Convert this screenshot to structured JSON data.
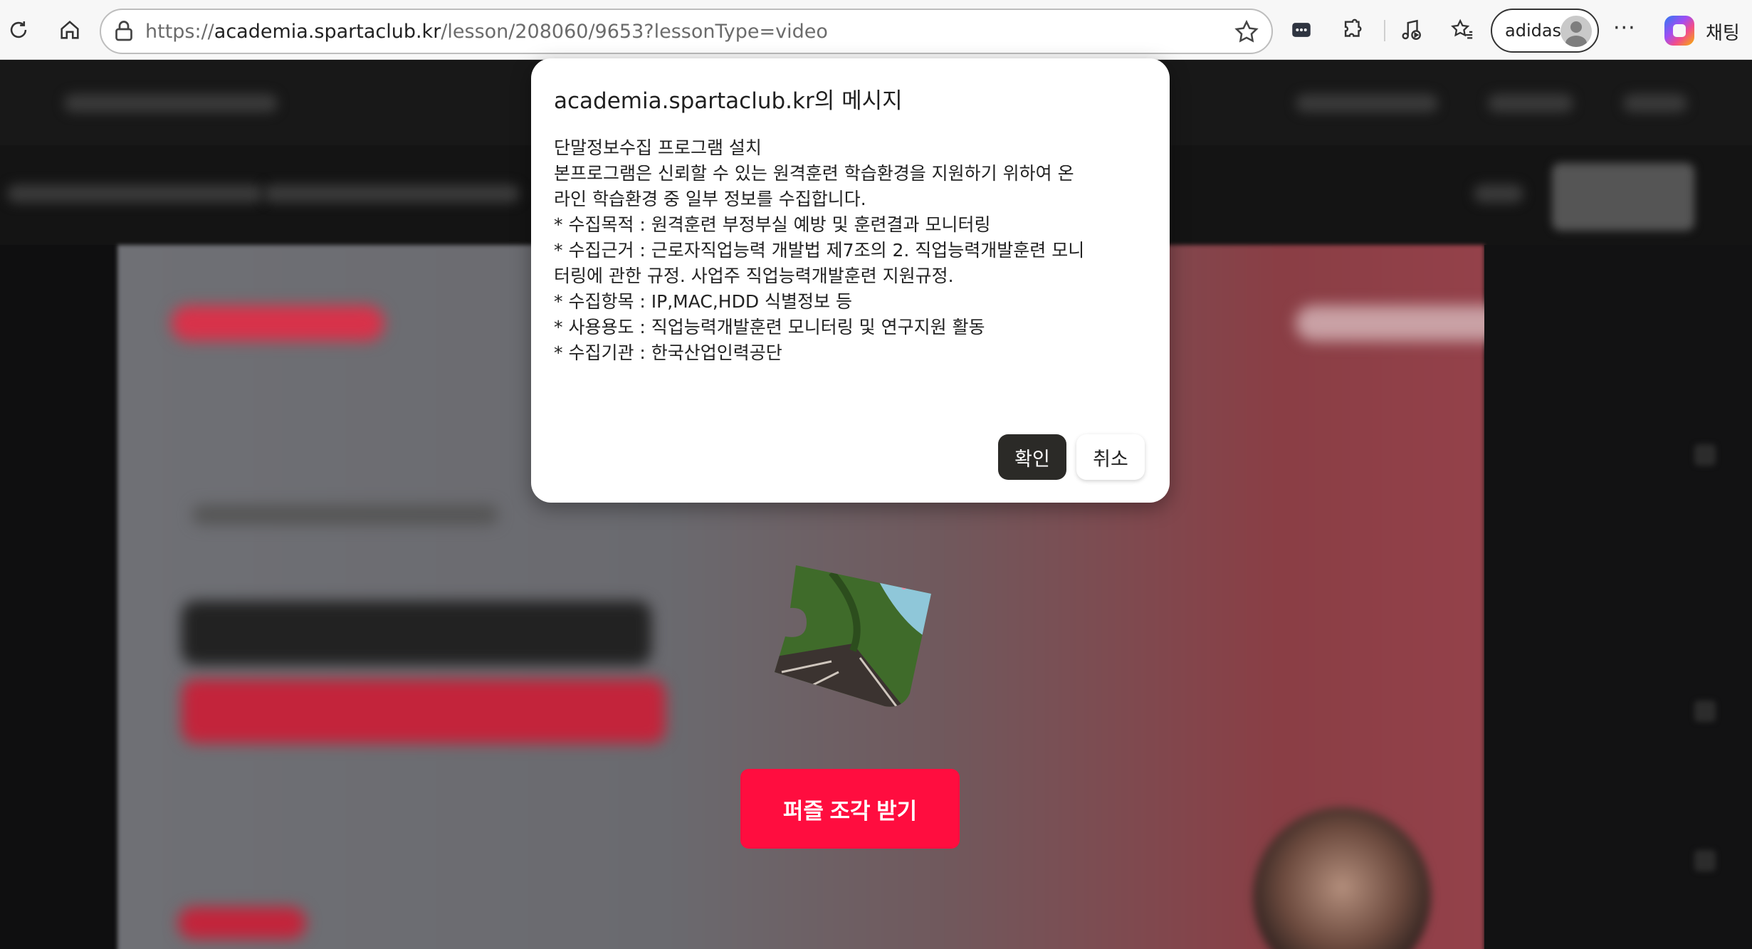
{
  "browser": {
    "url_scheme": "https://",
    "url_host": "academia.spartaclub.kr",
    "url_path": "/lesson/208060/9653?lessonType=video",
    "profile_name": "adidas",
    "more_label": "···",
    "chat_label": "채팅",
    "icons": [
      "refresh-icon",
      "home-icon",
      "site-info-icon",
      "favorite-star-icon",
      "extension-icon",
      "puzzle-extensions-icon",
      "media-control-icon",
      "favorites-icon",
      "more-icon",
      "copilot-icon"
    ]
  },
  "dialog": {
    "title": "academia.spartaclub.kr의 메시지",
    "lines": [
      "단말정보수집 프로그램 설치",
      "본프로그램은 신뢰할 수 있는 원격훈련 학습환경을 지원하기 위하여 온",
      "라인 학습환경 중 일부 정보를 수집합니다.",
      "* 수집목적 : 원격훈련 부정부실 예방 및 훈련결과 모니터링",
      "* 수집근거 : 근로자직업능력 개발법 제7조의 2. 직업능력개발훈련 모니",
      "터링에 관한 규정. 사업주 직업능력개발훈련 지원규정.",
      "* 수집항목 : IP,MAC,HDD 식별정보 등",
      "* 사용용도 : 직업능력개발훈련 모니터링 및 연구지원 활동",
      "* 수집기관 : 한국산업인력공단"
    ],
    "ok_label": "확인",
    "cancel_label": "취소"
  },
  "page": {
    "puzzle_button_label": "퍼즐 조각 받기"
  },
  "colors": {
    "accent_red": "#ff0d3f",
    "ok_button": "#2b2a27"
  }
}
